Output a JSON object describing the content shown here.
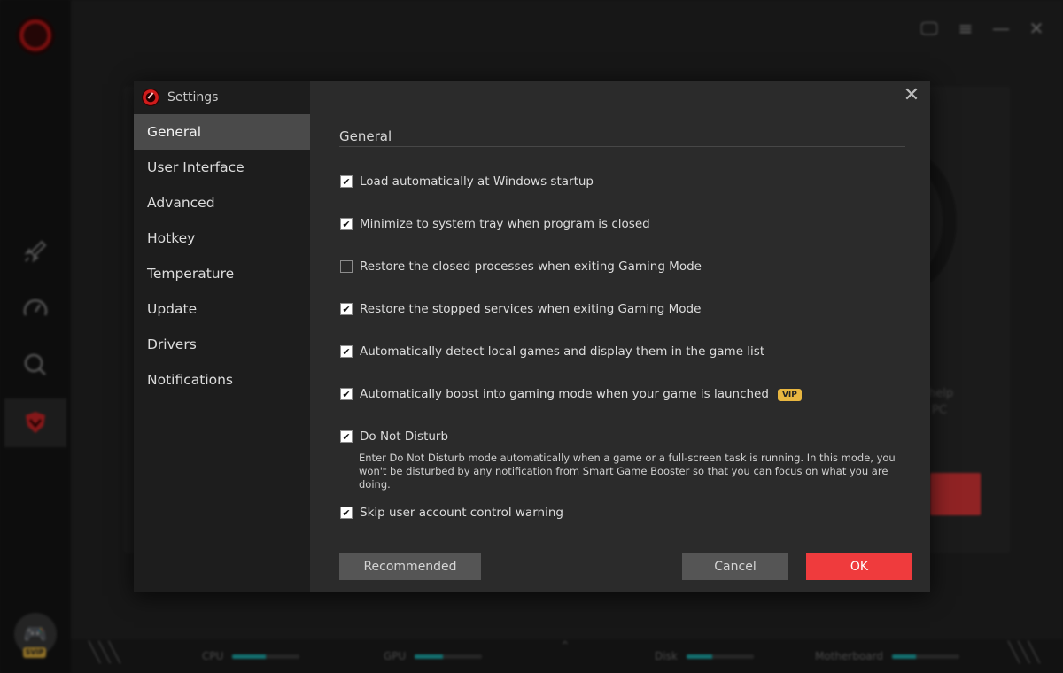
{
  "dialog": {
    "title": "Settings",
    "close_glyph": "✕",
    "nav": [
      {
        "label": "General",
        "active": true
      },
      {
        "label": "User Interface",
        "active": false
      },
      {
        "label": "Advanced",
        "active": false
      },
      {
        "label": "Hotkey",
        "active": false
      },
      {
        "label": "Temperature",
        "active": false
      },
      {
        "label": "Update",
        "active": false
      },
      {
        "label": "Drivers",
        "active": false
      },
      {
        "label": "Notifications",
        "active": false
      }
    ],
    "section_title": "General",
    "options": [
      {
        "label": "Load automatically at Windows startup",
        "checked": true
      },
      {
        "label": "Minimize to system tray when program is closed",
        "checked": true
      },
      {
        "label": "Restore the closed processes when exiting Gaming Mode",
        "checked": false
      },
      {
        "label": "Restore the stopped services when exiting Gaming Mode",
        "checked": true
      },
      {
        "label": "Automatically detect local games and display them in the game list",
        "checked": true
      },
      {
        "label": "Automatically boost into gaming mode when your game is launched",
        "checked": true,
        "badge": "VIP"
      },
      {
        "label": "Do Not Disturb",
        "checked": true
      },
      {
        "label": "Skip user account control warning",
        "checked": true
      }
    ],
    "dnd_description": "Enter Do Not Disturb mode automatically when a game or a full-screen task is running. In this mode, you won't be disturbed by any notification from Smart Game Booster so that you can focus on what you are doing.",
    "buttons": {
      "recommended": "Recommended",
      "cancel": "Cancel",
      "ok": "OK"
    }
  },
  "background": {
    "svip_badge": "SVIP",
    "partial_text_1": "help",
    "partial_text_2": "PC",
    "meters": [
      {
        "label": "CPU",
        "level": 0.5
      },
      {
        "label": "GPU",
        "level": 0.42
      },
      {
        "label": "Disk",
        "level": 0.38
      },
      {
        "label": "Motherboard",
        "level": 0.35
      }
    ]
  },
  "colors": {
    "accent": "#ef3b3d",
    "vip": "#e8b640",
    "meter": "#1fb4b4"
  }
}
